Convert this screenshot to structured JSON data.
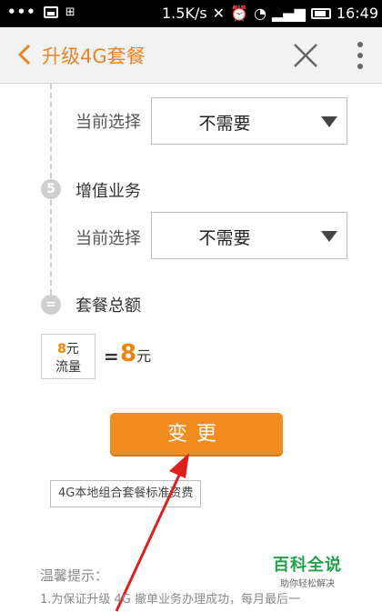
{
  "status_bar": {
    "dots": "•••",
    "net_speed": "1.5K/s",
    "time": "16:49",
    "icons": [
      "image-icon",
      "grid-icon",
      "mute-icon",
      "alarm-icon",
      "wifi-icon",
      "signal-icon",
      "battery-icon"
    ]
  },
  "header": {
    "title": "升级4G套餐",
    "back_icon": "chevron-left-icon",
    "close_icon": "close-icon",
    "more_icon": "more-vertical-icon",
    "accent_color": "#e8842a"
  },
  "sections": [
    {
      "select_label": "当前选择",
      "select_value": "不需要"
    },
    {
      "step_number": "5",
      "step_title": "增值业务",
      "select_label": "当前选择",
      "select_value": "不需要"
    },
    {
      "step_number": "=",
      "step_title": "套餐总额"
    }
  ],
  "total": {
    "fee_amount": "8",
    "fee_unit": "元",
    "fee_name": "流量",
    "equals": "=",
    "total_amount": "8",
    "total_unit": "元",
    "amount_color": "#f08300"
  },
  "change_button": {
    "label": "变更",
    "color": "#f28c1f"
  },
  "tariff_link": {
    "label": "4G本地组合套餐标准资费"
  },
  "tips": {
    "title": "温馨提示：",
    "line1": "1.为保证升级 4G 撤单业务办理成功，每月最后一"
  },
  "watermark": {
    "main": "百科全说",
    "sub": "助你轻松解决"
  }
}
